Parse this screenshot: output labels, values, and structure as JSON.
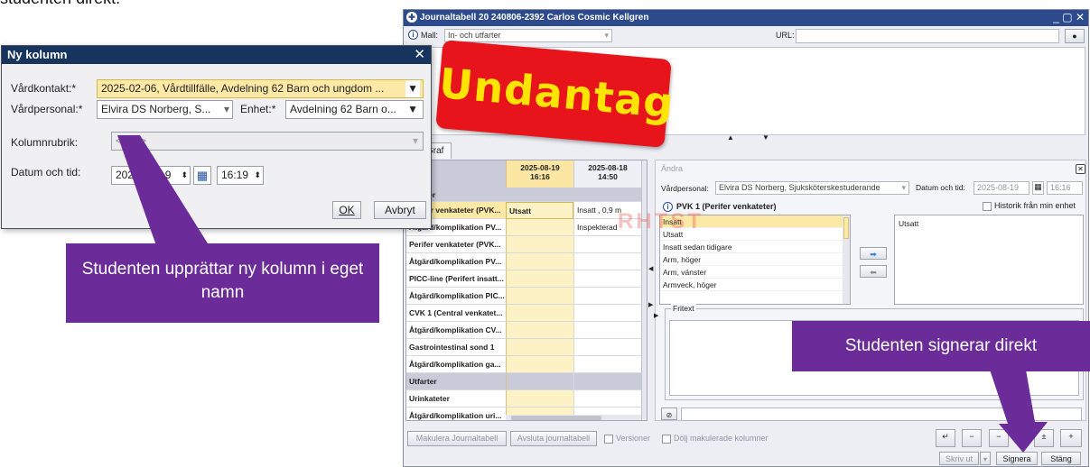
{
  "top_caption": "studenten direkt.",
  "main": {
    "title": "Journaltabell 20 240806-2392 Carlos Cosmic Kellgren",
    "window_controls": "_ ▢ ✕",
    "mall_label": "Mall:",
    "mall_value": "In- och utfarter",
    "url_label": "URL:",
    "tabs": [
      "Graf"
    ],
    "andra_label": "Ändra",
    "grid": {
      "col_headers": [
        {
          "date": "2025-08-19",
          "time": "16:16"
        },
        {
          "date": "2025-08-18",
          "time": "14:50"
        }
      ],
      "group_top": "Infarter",
      "rows": [
        {
          "label": "Perifer venkateter (PVK...",
          "c1": "Utsatt",
          "c2": "Insatt , 0,9 m"
        },
        {
          "label": "Åtgärd/komplikation PV...",
          "c1": "",
          "c2": "Inspekterad"
        },
        {
          "label": "Perifer venkateter (PVK...",
          "c1": "",
          "c2": ""
        },
        {
          "label": "Åtgärd/komplikation PV...",
          "c1": "",
          "c2": ""
        },
        {
          "label": "PICC-line (Perifert insatt...",
          "c1": "",
          "c2": ""
        },
        {
          "label": "Åtgärd/komplikation PIC...",
          "c1": "",
          "c2": ""
        },
        {
          "label": "CVK 1 (Central venkatet...",
          "c1": "",
          "c2": ""
        },
        {
          "label": "Åtgärd/komplikation CV...",
          "c1": "",
          "c2": ""
        },
        {
          "label": "Gastrointestinal sond 1",
          "c1": "",
          "c2": ""
        },
        {
          "label": "Åtgärd/komplikation ga...",
          "c1": "",
          "c2": ""
        },
        {
          "label": "Utfarter",
          "c1": "",
          "c2": "",
          "group": true
        },
        {
          "label": "Urinkateter",
          "c1": "",
          "c2": ""
        },
        {
          "label": "Åtgärd/komplikation uri...",
          "c1": "",
          "c2": ""
        }
      ]
    },
    "right": {
      "vardpersonal_label": "Vårdpersonal:",
      "vardpersonal_value": "Elvira DS Norberg, Sjuksköterskestuderande",
      "datum_label": "Datum och tid:",
      "datum_value": "2025-08-19",
      "tid_value": "16:16",
      "pvk_title": "PVK 1 (Perifer venkateter)",
      "historik_label": "Historik från min enhet",
      "options": [
        "Insatt",
        "Utsatt",
        "Insatt sedan tidigare",
        "Arm, höger",
        "Arm, vänster",
        "Armveck, höger"
      ],
      "selected_text": "Utsatt",
      "fritext_label": "Fritext",
      "watermark": "RHTST"
    },
    "bottom": {
      "makulera": "Makulera Journaltabell",
      "avsluta": "Avsluta journaltabell",
      "versioner": "Versioner",
      "dolj": "Dölj makulerade kolumner",
      "skriv_ut": "Skriv ut",
      "signera": "Signera",
      "stang": "Stäng"
    }
  },
  "dialog": {
    "title": "Ny kolumn",
    "vardkontakt_label": "Vårdkontakt:*",
    "vardkontakt_value": "2025-02-06, Vårdtillfälle, Avdelning 62 Barn och ungdom ...",
    "vardpersonal_label": "Vårdpersonal:*",
    "vardpersonal_value": "Elvira DS Norberg, S...",
    "enhet_label": "Enhet:*",
    "enhet_value": "Avdelning 62 Barn o...",
    "kolumnrubrik_label": "Kolumnrubrik:",
    "kolumnrubrik_value": "<Välj>",
    "datum_label": "Datum och tid:",
    "datum_value": "2025-08-19",
    "tid_value": "16:19",
    "ok": "OK",
    "avbryt": "Avbryt"
  },
  "overlays": {
    "stamp": "Undantag",
    "callout1": "Studenten upprättar ny kolumn i eget namn",
    "callout2": "Studenten signerar direkt"
  },
  "colors": {
    "accent": "#6b2c9a",
    "stamp_red": "#e8141c",
    "stamp_text": "#ffe400",
    "titlebar": "#2c4a8c",
    "highlight": "#fde9a6"
  }
}
